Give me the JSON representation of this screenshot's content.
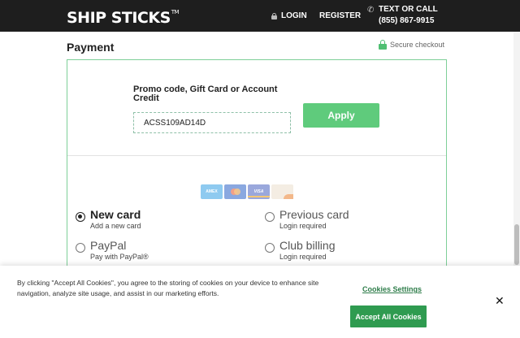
{
  "header": {
    "logo": "SHIP STICKS",
    "login": "LOGIN",
    "register": "REGISTER",
    "text_or_call": "TEXT OR CALL",
    "phone": "(855) 867-9915"
  },
  "page": {
    "title": "Payment",
    "secure_checkout": "Secure checkout"
  },
  "promo": {
    "label": "Promo code, Gift Card or Account Credit",
    "value": "ACSS109AD14D",
    "apply_label": "Apply"
  },
  "card_brands": [
    "AMEX",
    "Mastercard",
    "VISA",
    "DISCOVER"
  ],
  "payment_options": [
    {
      "title": "New card",
      "subtitle": "Add a new card",
      "selected": true
    },
    {
      "title": "Previous card",
      "subtitle": "Login required",
      "selected": false
    },
    {
      "title": "PayPal",
      "subtitle": "Pay with PayPal®",
      "selected": false
    },
    {
      "title": "Club billing",
      "subtitle": "Login required",
      "selected": false
    }
  ],
  "cookie_banner": {
    "text": "By clicking \"Accept All Cookies\", you agree to the storing of cookies on your device to enhance site navigation, analyze site usage, and assist in our marketing efforts.",
    "settings_label": "Cookies Settings",
    "accept_label": "Accept All Cookies",
    "close_label": "✕"
  },
  "colors": {
    "header_bg": "#1e1e1e",
    "accent_green": "#5fcb7c",
    "accept_green": "#2f9b50",
    "panel_border": "#7ecf98"
  }
}
